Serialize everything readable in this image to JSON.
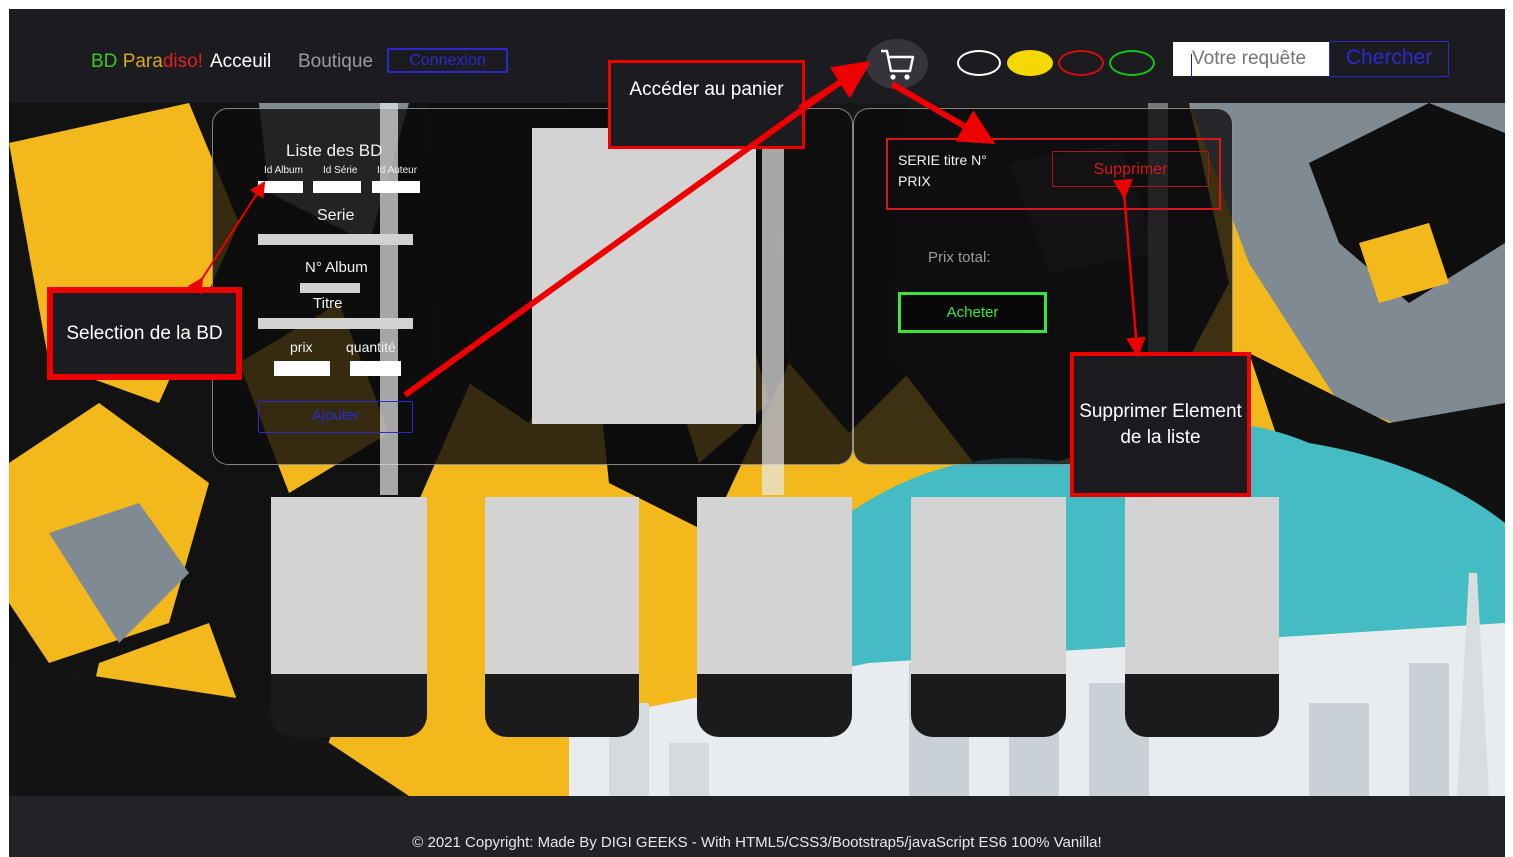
{
  "navbar": {
    "brand": "BD Paradiso!",
    "home": "Acceuil",
    "shop": "Boutique",
    "login": "Connexion",
    "search_placeholder": "Votre requête",
    "search_button": "Chercher",
    "cart_icon": "cart-icon",
    "theme_colors": [
      "#ffffff",
      "#f5d800",
      "#d01010",
      "#18c418"
    ]
  },
  "form": {
    "title": "Liste des BD",
    "id_album": "Id Album",
    "id_serie": "Id Série",
    "id_auteur": "Id Auteur",
    "serie": "Serie",
    "album_no": "N° Album",
    "titre": "Titre",
    "prix": "prix",
    "quantite": "quantité",
    "add_button": "Ajouter"
  },
  "cart": {
    "item_line1": "SERIE titre  N°",
    "item_line2": "PRIX",
    "remove_button": "Supprimer",
    "total_label": "Prix total:",
    "buy_button": "Acheter"
  },
  "annotations": {
    "selection": "Selection de la BD",
    "cart_access": "Accéder au panier",
    "remove_item": "Supprimer Element de la liste"
  },
  "colors": {
    "brand_green": "#3cc81e",
    "brand_red": "#e02020",
    "accent_blue": "#2a2ad0",
    "annotation_red": "#ee0000",
    "buy_green": "#39e639"
  },
  "footer": {
    "text": "© 2021 Copyright: Made By DIGI GEEKS - With HTML5/CSS3/Bootstrap5/javaScript ES6 100% Vanilla!"
  }
}
